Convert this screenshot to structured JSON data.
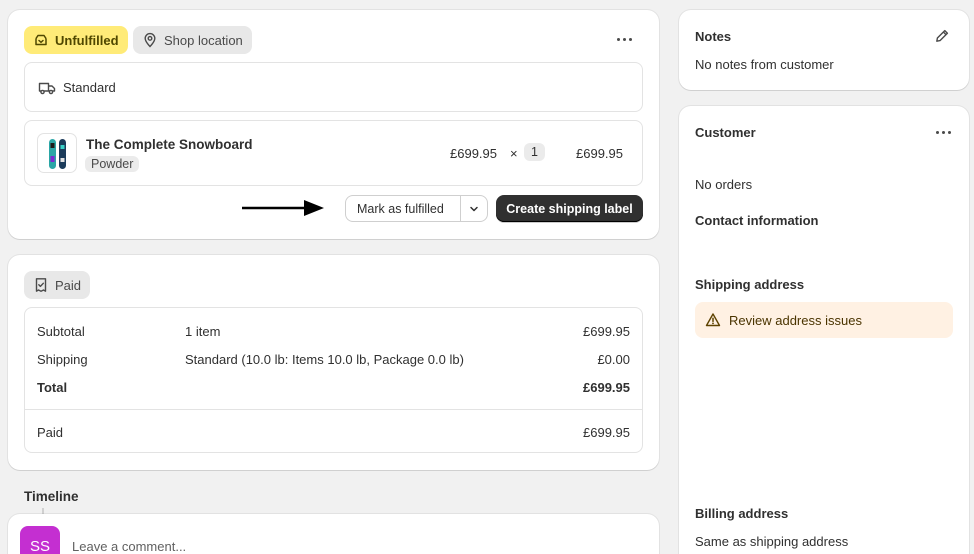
{
  "fulfillment": {
    "status_badge": "Unfulfilled",
    "location_badge": "Shop location",
    "shipping_method": "Standard",
    "product": {
      "name": "The Complete Snowboard",
      "variant": "Powder",
      "unit_price": "£699.95",
      "times": "×",
      "quantity": "1",
      "total": "£699.95"
    },
    "mark_fulfilled_label": "Mark as fulfilled",
    "create_label_button": "Create shipping label"
  },
  "payment": {
    "status_badge": "Paid",
    "rows": [
      {
        "label": "Subtotal",
        "detail": "1 item",
        "amount": "£699.95"
      },
      {
        "label": "Shipping",
        "detail": "Standard (10.0 lb: Items 10.0 lb, Package 0.0 lb)",
        "amount": "£0.00"
      },
      {
        "label": "Total",
        "detail": "",
        "amount": "£699.95"
      }
    ],
    "paid_label": "Paid",
    "paid_amount": "£699.95"
  },
  "timeline": {
    "title": "Timeline",
    "avatar_initials": "SS",
    "comment_placeholder": "Leave a comment..."
  },
  "notes": {
    "title": "Notes",
    "body": "No notes from customer"
  },
  "customer": {
    "title": "Customer",
    "orders": "No orders",
    "contact_title": "Contact information",
    "shipping_title": "Shipping address",
    "address_warning": "Review address issues",
    "billing_title": "Billing address",
    "billing_value": "Same as shipping address"
  },
  "colors": {
    "unfulfilled_badge_bg": "#ffeb78",
    "neutral_badge_bg": "#e8e8e8",
    "primary_button_bg": "#303030",
    "warning_bg": "#fff1e3",
    "avatar_bg": "#c42fd1"
  }
}
